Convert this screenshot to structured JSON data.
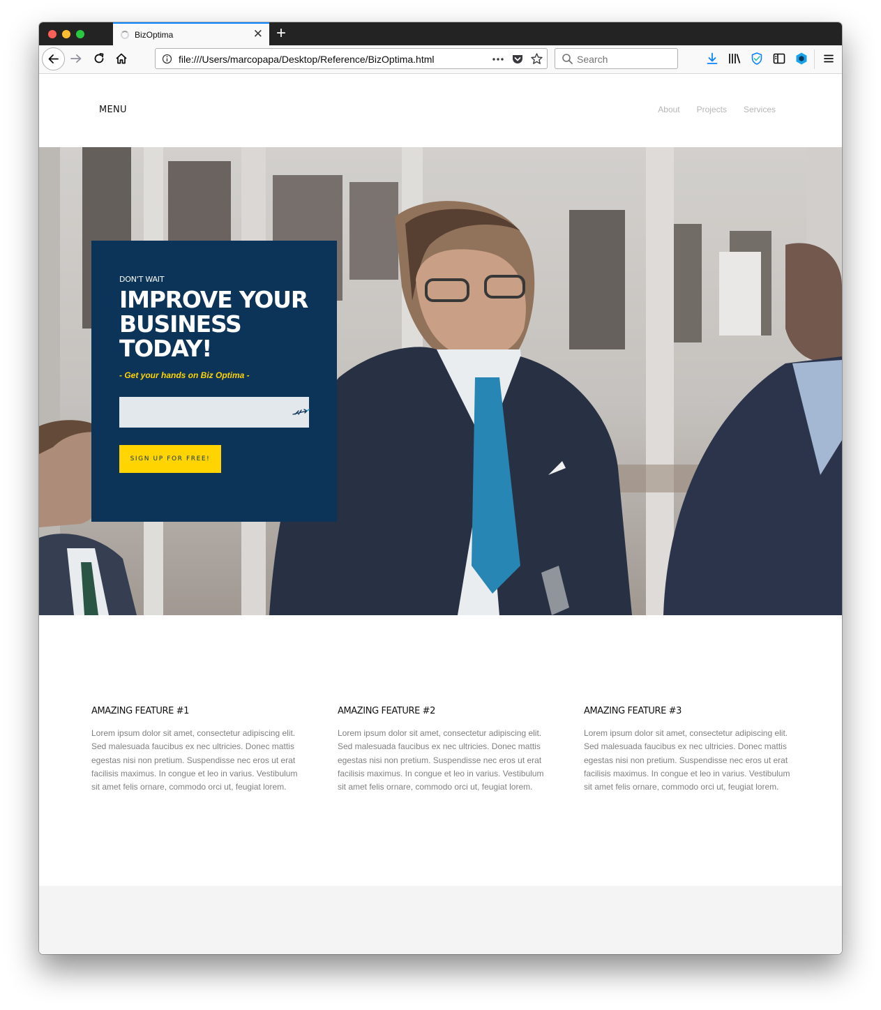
{
  "browser": {
    "tab_title": "BizOptima",
    "url": "file:///Users/marcopapa/Desktop/Reference/BizOptima.html",
    "search_placeholder": "Search"
  },
  "site": {
    "menu_label": "MENU",
    "nav": [
      "About",
      "Projects",
      "Services"
    ]
  },
  "hero": {
    "eyebrow": "DON'T WAIT",
    "title": "IMPROVE YOUR BUSINESS TODAY!",
    "subtitle": "- Get your hands on Biz Optima -",
    "input_value": "",
    "button_label": "SIGN UP FOR FREE!"
  },
  "features": [
    {
      "title": "AMAZING FEATURE #1",
      "text": "Lorem ipsum dolor sit amet, consectetur adipiscing elit. Sed malesuada faucibus ex nec ultricies. Donec mattis egestas nisi non pretium. Suspendisse nec eros ut erat facilisis maximus. In congue et leo in varius. Vestibulum sit amet felis ornare, commodo orci ut, feugiat lorem."
    },
    {
      "title": "AMAZING FEATURE #2",
      "text": "Lorem ipsum dolor sit amet, consectetur adipiscing elit. Sed malesuada faucibus ex nec ultricies. Donec mattis egestas nisi non pretium. Suspendisse nec eros ut erat facilisis maximus. In congue et leo in varius. Vestibulum sit amet felis ornare, commodo orci ut, feugiat lorem."
    },
    {
      "title": "AMAZING FEATURE #3",
      "text": "Lorem ipsum dolor sit amet, consectetur adipiscing elit. Sed malesuada faucibus ex nec ultricies. Donec mattis egestas nisi non pretium. Suspendisse nec eros ut erat facilisis maximus. In congue et leo in varius. Vestibulum sit amet felis ornare, commodo orci ut, feugiat lorem."
    }
  ],
  "colors": {
    "brand_navy": "#0c3358",
    "accent_yellow": "#ffd400",
    "tab_accent": "#0a84ff"
  },
  "icons": [
    "back-icon",
    "forward-icon",
    "reload-icon",
    "home-icon",
    "info-icon",
    "page-actions-icon",
    "pocket-icon",
    "bookmark-star-icon",
    "search-icon",
    "download-icon",
    "library-icon",
    "tracking-shield-icon",
    "sidebar-icon",
    "extension-icon",
    "hamburger-menu-icon",
    "send-icon"
  ]
}
